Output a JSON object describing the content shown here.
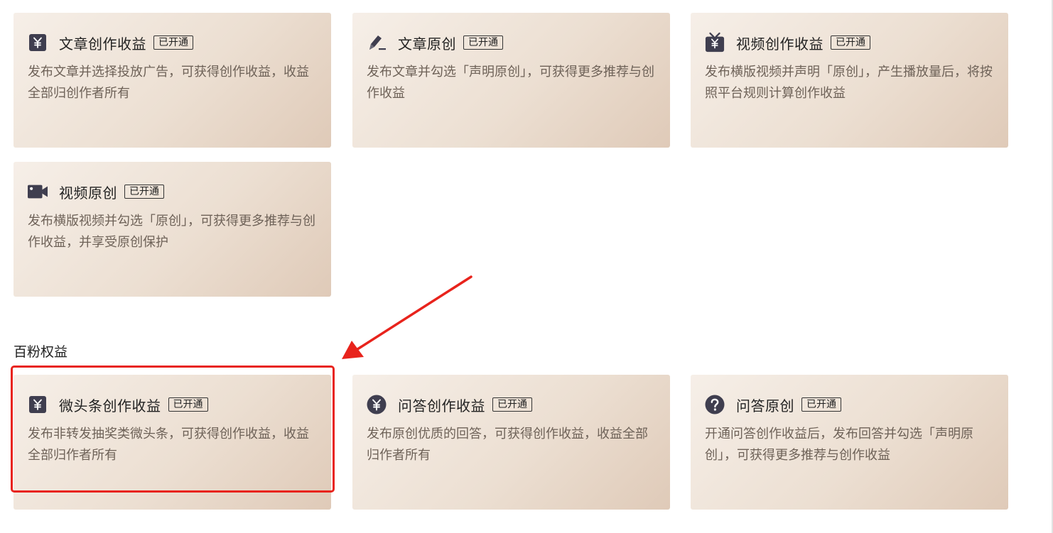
{
  "badge_label": "已开通",
  "section_title": "百粉权益",
  "colors": {
    "highlight": "#e8231c",
    "icon": "#3f3e4f",
    "card_gradient_start": "#f6efe8",
    "card_gradient_end": "#dfcab8"
  },
  "cards": [
    {
      "title": "文章创作收益",
      "desc": "发布文章并选择投放广告，可获得创作收益，收益全部归创作者所有",
      "icon": "yuan-square-icon"
    },
    {
      "title": "文章原创",
      "desc": "发布文章并勾选「声明原创」，可获得更多推荐与创作收益",
      "icon": "pen-icon"
    },
    {
      "title": "视频创作收益",
      "desc": "发布横版视频并声明「原创」，产生播放量后，将按照平台规则计算创作收益",
      "icon": "tv-yuan-icon"
    },
    {
      "title": "视频原创",
      "desc": "发布横版视频并勾选「原创」，可获得更多推荐与创作收益，并享受原创保护",
      "icon": "video-camera-icon"
    },
    {
      "title": "微头条创作收益",
      "desc": "发布非转发抽奖类微头条，可获得创作收益，收益全部归作者所有",
      "icon": "yuan-square-icon"
    },
    {
      "title": "问答创作收益",
      "desc": "发布原创优质的回答，可获得创作收益，收益全部归作者所有",
      "icon": "yuan-circle-icon"
    },
    {
      "title": "问答原创",
      "desc": "开通问答创作收益后，发布回答并勾选「声明原创」，可获得更多推荐与创作收益",
      "icon": "question-circle-icon"
    }
  ]
}
